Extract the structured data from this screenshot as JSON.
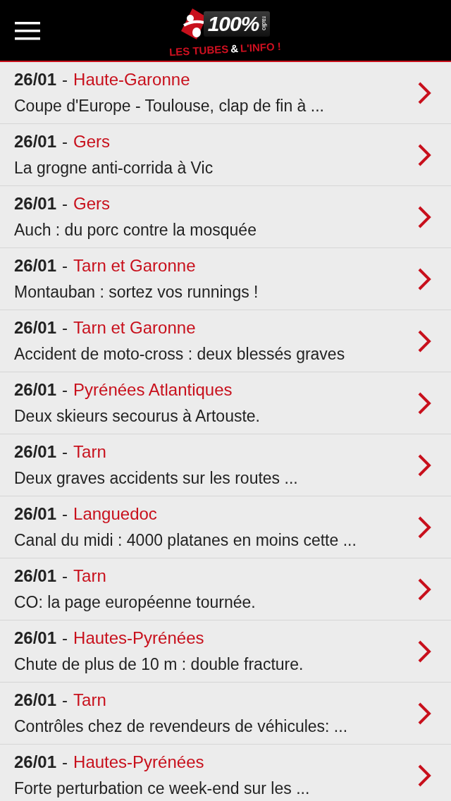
{
  "header": {
    "logo": {
      "number": "100%",
      "radio": "radio",
      "slogan_left": "LES TUBES",
      "ampersand": "&",
      "slogan_right": "L'INFO !"
    }
  },
  "articles": [
    {
      "date": "26/01",
      "separator": "-",
      "region": "Haute-Garonne",
      "title": "Coupe d'Europe - Toulouse, clap de fin à ..."
    },
    {
      "date": "26/01",
      "separator": "-",
      "region": "Gers",
      "title": "La grogne anti-corrida à Vic"
    },
    {
      "date": "26/01",
      "separator": "-",
      "region": "Gers",
      "title": "Auch : du porc contre la mosquée"
    },
    {
      "date": "26/01",
      "separator": "-",
      "region": "Tarn et Garonne",
      "title": "Montauban : sortez vos runnings !"
    },
    {
      "date": "26/01",
      "separator": "-",
      "region": "Tarn et Garonne",
      "title": "Accident de moto-cross : deux blessés graves"
    },
    {
      "date": "26/01",
      "separator": "-",
      "region": "Pyrénées Atlantiques",
      "title": "Deux skieurs secourus à Artouste."
    },
    {
      "date": "26/01",
      "separator": "-",
      "region": "Tarn",
      "title": "Deux graves accidents sur les routes ..."
    },
    {
      "date": "26/01",
      "separator": "-",
      "region": "Languedoc",
      "title": "Canal du midi : 4000 platanes en moins cette ..."
    },
    {
      "date": "26/01",
      "separator": "-",
      "region": "Tarn",
      "title": "CO: la page européenne tournée."
    },
    {
      "date": "26/01",
      "separator": "-",
      "region": "Hautes-Pyrénées",
      "title": "Chute de plus de 10 m : double fracture."
    },
    {
      "date": "26/01",
      "separator": "-",
      "region": "Tarn",
      "title": "Contrôles chez de revendeurs de véhicules: ..."
    },
    {
      "date": "26/01",
      "separator": "-",
      "region": "Hautes-Pyrénées",
      "title": "Forte perturbation ce week-end sur les ..."
    }
  ]
}
